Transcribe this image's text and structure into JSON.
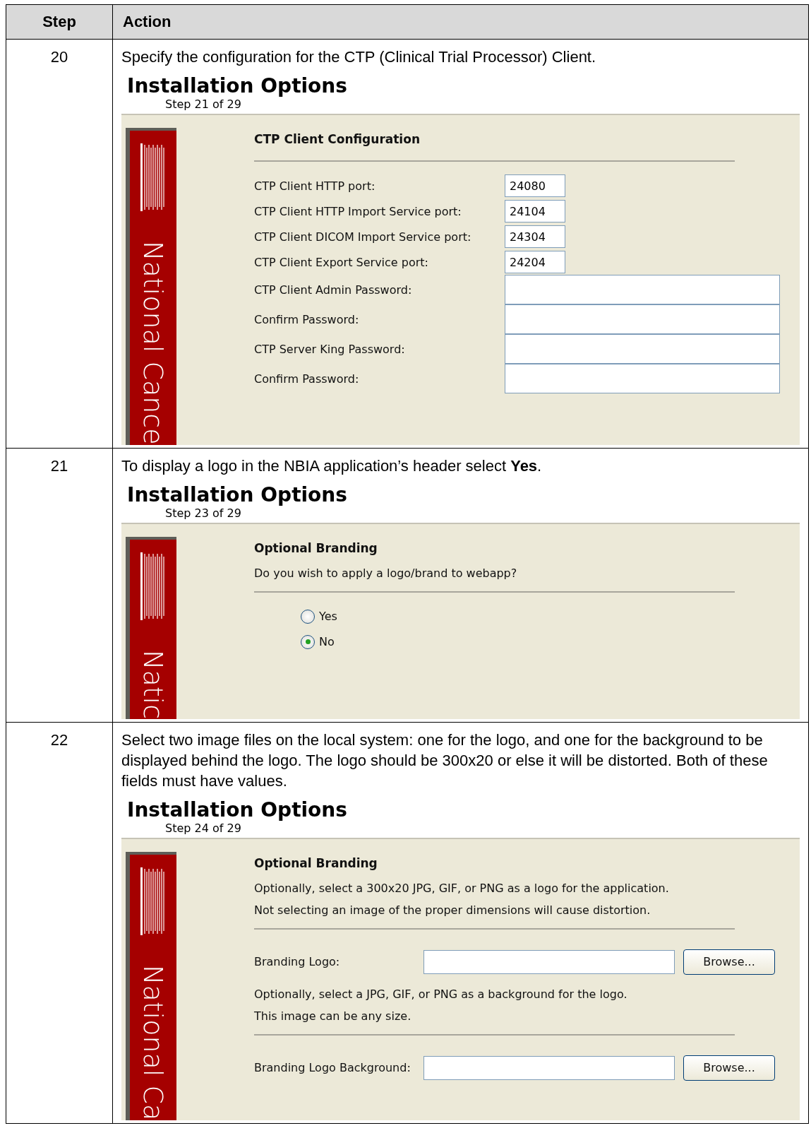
{
  "table": {
    "columns": [
      "Step",
      "Action"
    ],
    "rows": [
      {
        "step": "20",
        "instruction": "Specify the configuration for the CTP (Clinical Trial Processor) Client.",
        "screen": {
          "heading": "Installation Options",
          "step_label": "Step 21 of 29",
          "sidebar_text": "National Cance",
          "items": [
            {
              "kind": "title",
              "text": "CTP Client Configuration"
            },
            {
              "kind": "rule"
            },
            {
              "kind": "short_field",
              "label": "CTP Client HTTP port:",
              "value": "24080"
            },
            {
              "kind": "short_field",
              "label": "CTP Client HTTP Import Service port:",
              "value": "24104"
            },
            {
              "kind": "short_field",
              "label": "CTP Client DICOM Import Service port:",
              "value": "24304"
            },
            {
              "kind": "short_field",
              "label": "CTP Client Export Service port:",
              "value": "24204"
            },
            {
              "kind": "long_field",
              "label": "CTP Client Admin Password:"
            },
            {
              "kind": "long_field",
              "label": "Confirm Password:"
            },
            {
              "kind": "long_field",
              "label": "CTP Server King Password:"
            },
            {
              "kind": "long_field",
              "label": "Confirm Password:"
            }
          ]
        }
      },
      {
        "step": "21",
        "instruction": "To display a logo in the NBIA application’s header select **Yes**.",
        "screen": {
          "heading": "Installation Options",
          "step_label": "Step 23 of 29",
          "sidebar_text": "Natic",
          "items": [
            {
              "kind": "title",
              "text": "Optional Branding"
            },
            {
              "kind": "note",
              "text": "Do you wish to apply a logo/brand to webapp?"
            },
            {
              "kind": "rule"
            },
            {
              "kind": "radio",
              "label": "Yes",
              "selected": false
            },
            {
              "kind": "radio",
              "label": "No",
              "selected": true
            }
          ]
        }
      },
      {
        "step": "22",
        "instruction": "Select two image files on the local system: one for the logo, and one for the background to be displayed behind the logo.  The logo should be 300x20 or else it will be distorted.  Both of these fields must have values.",
        "screen": {
          "heading": "Installation Options",
          "step_label": "Step 24 of 29",
          "sidebar_text": "National Ca",
          "items": [
            {
              "kind": "title",
              "text": "Optional Branding"
            },
            {
              "kind": "note",
              "text": "Optionally, select a 300x20 JPG, GIF, or PNG as a logo for the application."
            },
            {
              "kind": "note",
              "text": "Not selecting an image of the proper dimensions will cause distortion."
            },
            {
              "kind": "rule"
            },
            {
              "kind": "file_field",
              "label": "Branding Logo:",
              "button": "Browse..."
            },
            {
              "kind": "note",
              "text": "Optionally, select a JPG, GIF, or PNG as a background for the logo."
            },
            {
              "kind": "note",
              "text": "This image can be any size."
            },
            {
              "kind": "rule"
            },
            {
              "kind": "file_field",
              "label": "Branding Logo Background:",
              "button": "Browse..."
            }
          ]
        }
      }
    ]
  }
}
